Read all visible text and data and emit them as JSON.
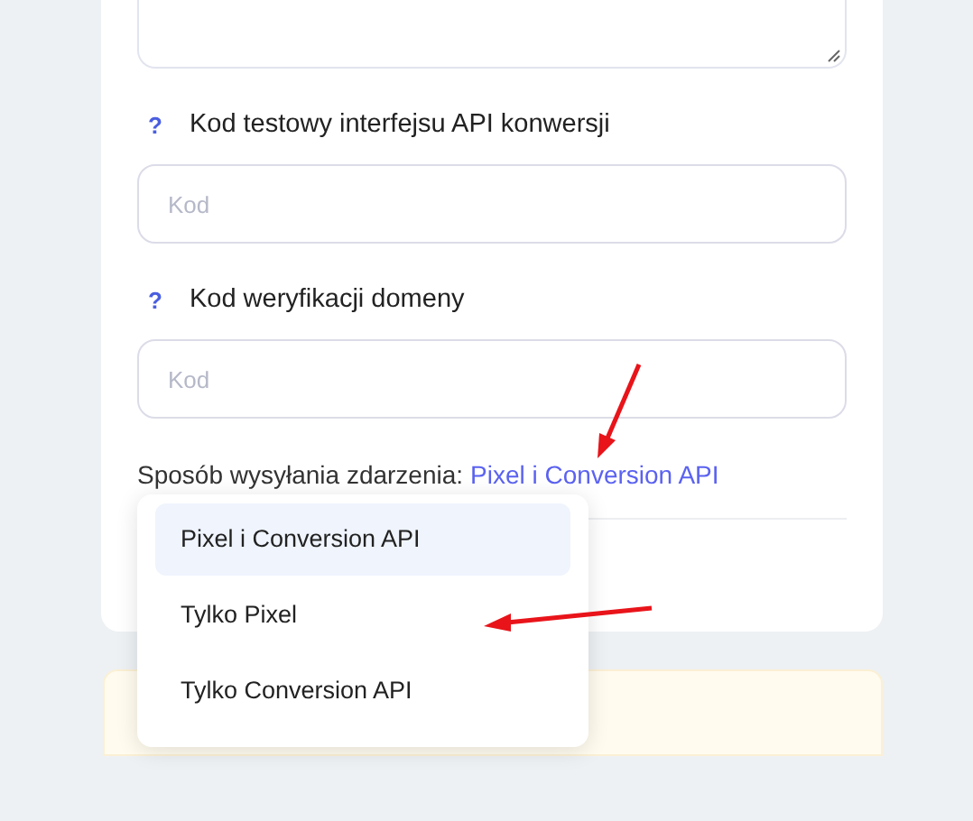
{
  "fields": [
    {
      "label": "Kod testowy interfejsu API konwersji",
      "help": "?",
      "placeholder": "Kod"
    },
    {
      "label": "Kod weryfikacji domeny",
      "help": "?",
      "placeholder": "Kod"
    }
  ],
  "sending_method": {
    "label": "Sposób wysyłania zdarzenia:",
    "value": "Pixel i Conversion API"
  },
  "dropdown": {
    "options": [
      {
        "label": "Pixel i Conversion API",
        "selected": true
      },
      {
        "label": "Tylko Pixel",
        "selected": false
      },
      {
        "label": "Tylko Conversion API",
        "selected": false
      }
    ]
  }
}
